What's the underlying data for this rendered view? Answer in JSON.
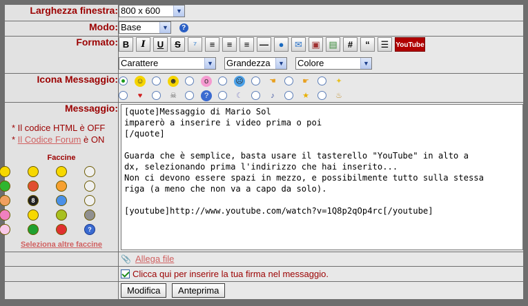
{
  "labels": {
    "window_width": "Larghezza finestra:",
    "mode": "Modo:",
    "format": "Formato:",
    "icon": "Icona Messaggio:",
    "message": "Messaggio:"
  },
  "window_width": {
    "value": "800 x 600"
  },
  "mode": {
    "value": "Base",
    "help": "?"
  },
  "toolbar": {
    "bold": "B",
    "italic": "I",
    "underline": "U",
    "strike": "S",
    "code": "#",
    "quote": "“",
    "youtube": "YouTube"
  },
  "format_selects": {
    "font": "Carattere",
    "size": "Grandezza",
    "color": "Colore"
  },
  "notes": {
    "html": "* Il codice HTML è OFF",
    "forum_prefix": "* ",
    "forum_link": "Il Codice Forum",
    "forum_suffix": " è ON"
  },
  "faccine": {
    "title": "Faccine",
    "more": "Seleziona altre faccine"
  },
  "message_text": "[quote]Messaggio di Mario Sol\nimparerò a inserire i video prima o poi\n[/quote]\n\nGuarda che è semplice, basta usare il tasterello \"YouTube\" in alto a\ndx, selezionando prima l'indirizzo che hai inserito...\nNon ci devono essere spazi in mezzo, e possibilmente tutto sulla stessa\nriga (a meno che non va a capo da solo).\n\n[youtube]http://www.youtube.com/watch?v=1Q8p2qOp4rc[/youtube]",
  "attach": {
    "label": "Allega file"
  },
  "signature": {
    "label": "Clicca qui per inserire la tua firma nel messaggio.",
    "checked": true
  },
  "buttons": {
    "modify": "Modifica",
    "preview": "Anteprima"
  }
}
